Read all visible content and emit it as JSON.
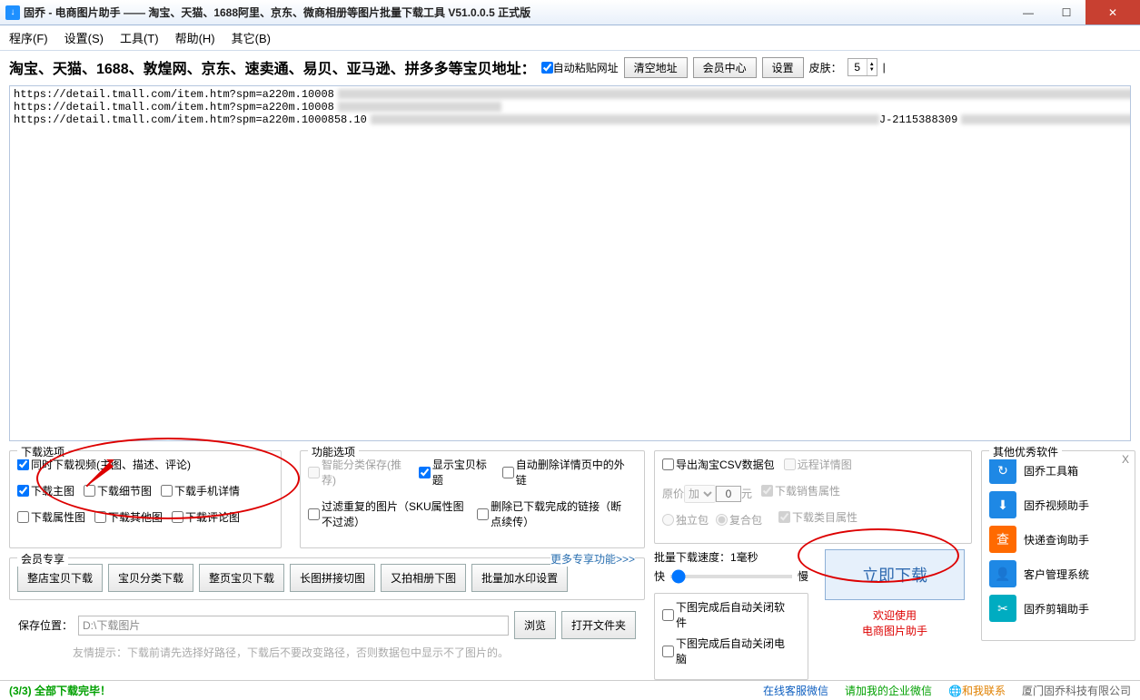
{
  "titlebar": {
    "title": "固乔 - 电商图片助手 —— 淘宝、天猫、1688阿里、京东、微商相册等图片批量下载工具 V51.0.0.5 正式版"
  },
  "menubar": [
    "程序(F)",
    "设置(S)",
    "工具(T)",
    "帮助(H)",
    "其它(B)"
  ],
  "address_label": "淘宝、天猫、1688、敦煌网、京东、速卖通、易贝、亚马逊、拼多多等宝贝地址：",
  "auto_paste_label": "自动粘贴网址",
  "btn_clear": "清空地址",
  "btn_member": "会员中心",
  "btn_settings": "设置",
  "skin_label": "皮肤：",
  "skin_value": "5",
  "urls": [
    "https://detail.tmall.com/item.htm?spm=a220m.10008",
    "https://detail.tmall.com/item.htm?spm=a220m.10008",
    "https://detail.tmall.com/item.htm?spm=a220m.1000858.10"
  ],
  "dl_options_title": "下载选项",
  "dl_video_label": "同时下载视频(主图、描述、评论)",
  "dl_main_img": "下载主图",
  "dl_detail_img": "下载细节图",
  "dl_mobile_detail": "下载手机详情",
  "dl_attr_img": "下载属性图",
  "dl_other_img": "下载其他图",
  "dl_comment_img": "下载评论图",
  "func_options_title": "功能选项",
  "smart_save": "智能分类保存(推荐)",
  "show_title": "显示宝贝标题",
  "auto_del_ext": "自动删除详情页中的外链",
  "filter_dup": "过滤重复的图片（SKU属性图不过滤）",
  "del_done": "删除已下载完成的链接（断点续传）",
  "export_csv": "导出淘宝CSV数据包",
  "remote_detail": "远程详情图",
  "orig_price_label": "原价",
  "price_op_options": [
    "加"
  ],
  "price_value": "0",
  "price_unit": "元",
  "dl_sale_attr": "下载销售属性",
  "pkg_single": "独立包",
  "pkg_combo": "复合包",
  "dl_cat_attr": "下载类目属性",
  "member_title": "会员专享",
  "more_member": "更多专享功能>>>",
  "member_btns": [
    "整店宝贝下载",
    "宝贝分类下载",
    "整页宝贝下载",
    "长图拼接切图",
    "又拍相册下图",
    "批量加水印设置"
  ],
  "batch_speed_label": "批量下载速度：1毫秒",
  "fast_label": "快",
  "slow_label": "慢",
  "auto_close_soft": "下图完成后自动关闭软件",
  "auto_close_pc": "下图完成后自动关闭电脑",
  "download_btn": "立即下载",
  "welcome1": "欢迎使用",
  "welcome2": "电商图片助手",
  "save_label": "保存位置：",
  "save_path": "D:\\下载图片",
  "browse_btn": "浏览",
  "open_folder_btn": "打开文件夹",
  "hint": "友情提示：下载前请先选择好路径，下载后不要改变路径，否则数据包中显示不了图片的。",
  "status_left": "(3/3) 全部下载完毕！",
  "status_links": {
    "cs_wechat": "在线客服微信",
    "add_wechat": "请加我的企业微信",
    "contact_me": "和我联系",
    "company": "厦门固乔科技有限公司"
  },
  "other_soft_title": "其他优秀软件",
  "soft_items": [
    {
      "name": "固乔工具箱",
      "color": "#1e88e5"
    },
    {
      "name": "固乔视频助手",
      "color": "#1e88e5"
    },
    {
      "name": "快递查询助手",
      "color": "#ff6a00"
    },
    {
      "name": "客户管理系统",
      "color": "#1e88e5"
    },
    {
      "name": "固乔剪辑助手",
      "color": "#00acc1"
    }
  ]
}
